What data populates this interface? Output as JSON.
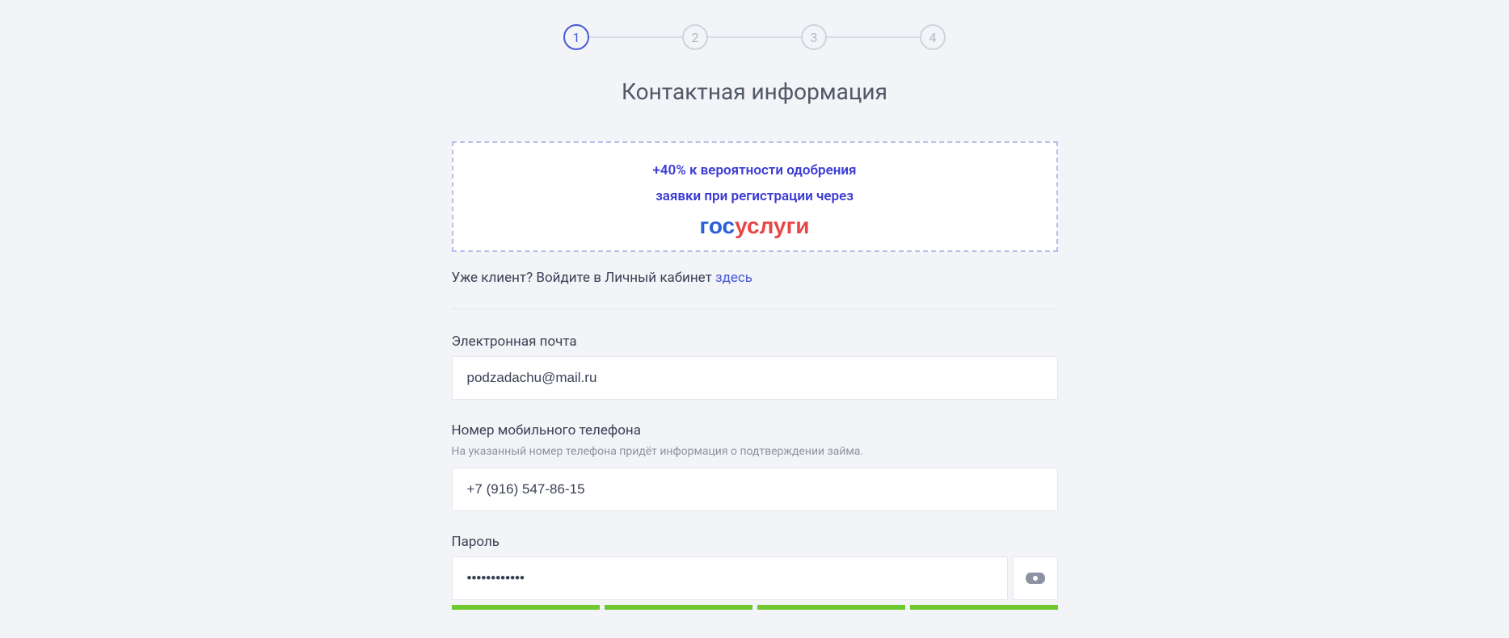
{
  "stepper": {
    "steps": [
      "1",
      "2",
      "3",
      "4"
    ],
    "active": 1
  },
  "title": "Контактная информация",
  "promo": {
    "line1": "+40% к вероятности одобрения",
    "line2": "заявки при регистрации через",
    "logo_part1": "гос",
    "logo_part2": "услуги"
  },
  "already_client": {
    "text": "Уже клиент? Войдите в Личный кабинет ",
    "link": "здесь"
  },
  "fields": {
    "email": {
      "label": "Электронная почта",
      "value": "podzadachu@mail.ru"
    },
    "phone": {
      "label": "Номер мобильного телефона",
      "hint": "На указанный номер телефона придёт информация о подтверждении займа.",
      "value": "+7 (916) 547-86-15"
    },
    "password": {
      "label": "Пароль",
      "value": "••••••••••••",
      "strength_segments": 4
    }
  }
}
